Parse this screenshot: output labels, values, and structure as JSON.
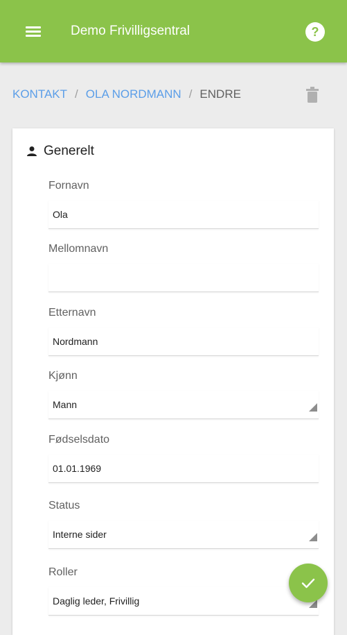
{
  "appbar": {
    "title": "Demo Frivilligsentral",
    "menu_icon": "menu-icon",
    "help_icon": "help-icon",
    "help_glyph": "?"
  },
  "breadcrumb": {
    "items": [
      "KONTAKT",
      "OLA NORDMANN"
    ],
    "current": "ENDRE",
    "separator": "/",
    "delete_icon": "trash-icon"
  },
  "section": {
    "icon": "person-icon",
    "title": "Generelt"
  },
  "fields": {
    "first_name": {
      "label": "Fornavn",
      "value": "Ola"
    },
    "middle_name": {
      "label": "Mellomnavn",
      "value": ""
    },
    "last_name": {
      "label": "Etternavn",
      "value": "Nordmann"
    },
    "gender": {
      "label": "Kjønn",
      "value": "Mann"
    },
    "birth_date": {
      "label": "Fødselsdato",
      "value": "01.01.1969"
    },
    "status": {
      "label": "Status",
      "value": "Interne sider"
    },
    "roles": {
      "label": "Roller",
      "value": "Daglig leder, Frivillig"
    }
  },
  "fab": {
    "icon": "check-icon"
  },
  "colors": {
    "primary": "#8bc34a",
    "link": "#5b9ee8",
    "background": "#ececec"
  }
}
